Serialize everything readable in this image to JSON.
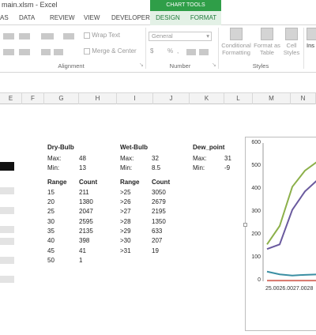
{
  "window": {
    "title": "main.xlsm - Excel"
  },
  "chart_tools_label": "CHART TOOLS",
  "tabs": [
    {
      "label": "AS"
    },
    {
      "label": "DATA"
    },
    {
      "label": "REVIEW"
    },
    {
      "label": "VIEW"
    },
    {
      "label": "DEVELOPER"
    },
    {
      "label": "DESIGN"
    },
    {
      "label": "FORMAT"
    }
  ],
  "ribbon": {
    "alignment": {
      "wrap_text": "Wrap Text",
      "merge_center": "Merge & Center",
      "label": "Alignment"
    },
    "number": {
      "format_value": "General",
      "currency": "$",
      "percent": "%",
      "label": "Number"
    },
    "styles": {
      "conditional": [
        "Conditional",
        "Formatting"
      ],
      "format_as": [
        "Format as",
        "Table"
      ],
      "cell_styles": [
        "Cell",
        "Styles"
      ],
      "label": "Styles"
    },
    "insert_partial": "Ins"
  },
  "columns": [
    "E",
    "F",
    "G",
    "H",
    "I",
    "J",
    "K",
    "L",
    "M",
    "N"
  ],
  "dry_bulb": {
    "title": "Dry-Bulb",
    "max_label": "Max:",
    "max_value": "48",
    "min_label": "Min:",
    "min_value": "13",
    "range_header": "Range",
    "count_header": "Count",
    "rows": [
      {
        "range": "15",
        "count": "211"
      },
      {
        "range": "20",
        "count": "1380"
      },
      {
        "range": "25",
        "count": "2047"
      },
      {
        "range": "30",
        "count": "2595"
      },
      {
        "range": "35",
        "count": "2135"
      },
      {
        "range": "40",
        "count": "398"
      },
      {
        "range": "45",
        "count": "41"
      },
      {
        "range": "50",
        "count": "1"
      }
    ]
  },
  "wet_bulb": {
    "title": "Wet-Bulb",
    "max_label": "Max:",
    "max_value": "32",
    "min_label": "Min:",
    "min_value": "8.5",
    "range_header": "Range",
    "count_header": "Count",
    "rows": [
      {
        "range": ">25",
        "count": "3050"
      },
      {
        "range": ">26",
        "count": "2679"
      },
      {
        "range": ">27",
        "count": "2195"
      },
      {
        "range": ">28",
        "count": "1350"
      },
      {
        "range": ">29",
        "count": "633"
      },
      {
        "range": ">30",
        "count": "207"
      },
      {
        "range": ">31",
        "count": "19"
      }
    ]
  },
  "dew_point": {
    "title": "Dew_point",
    "max_label": "Max:",
    "max_value": "31",
    "min_label": "Min:",
    "min_value": "-9"
  },
  "chart_data": {
    "type": "line",
    "ylim": [
      0,
      600
    ],
    "yticks": [
      "600",
      "500",
      "400",
      "300",
      "200",
      "100",
      "0"
    ],
    "x_tick_text": "25.0026.0027.0028",
    "x_index": [
      0,
      1,
      2,
      3,
      4
    ],
    "series": [
      {
        "color": "#8cb04a",
        "values": [
          160,
          240,
          410,
          480,
          520
        ]
      },
      {
        "color": "#6a5a9e",
        "values": [
          140,
          160,
          310,
          390,
          440
        ]
      },
      {
        "color": "#3b8fa3",
        "values": [
          42,
          30,
          25,
          28,
          30
        ]
      },
      {
        "color": "#d8746a",
        "values": [
          3,
          3,
          3,
          3,
          3
        ]
      }
    ],
    "colors": {
      "green": "#8cb04a",
      "purple": "#6a5a9e",
      "teal": "#3b8fa3",
      "red": "#d8746a",
      "chart_tools": "#2f9e48"
    }
  }
}
